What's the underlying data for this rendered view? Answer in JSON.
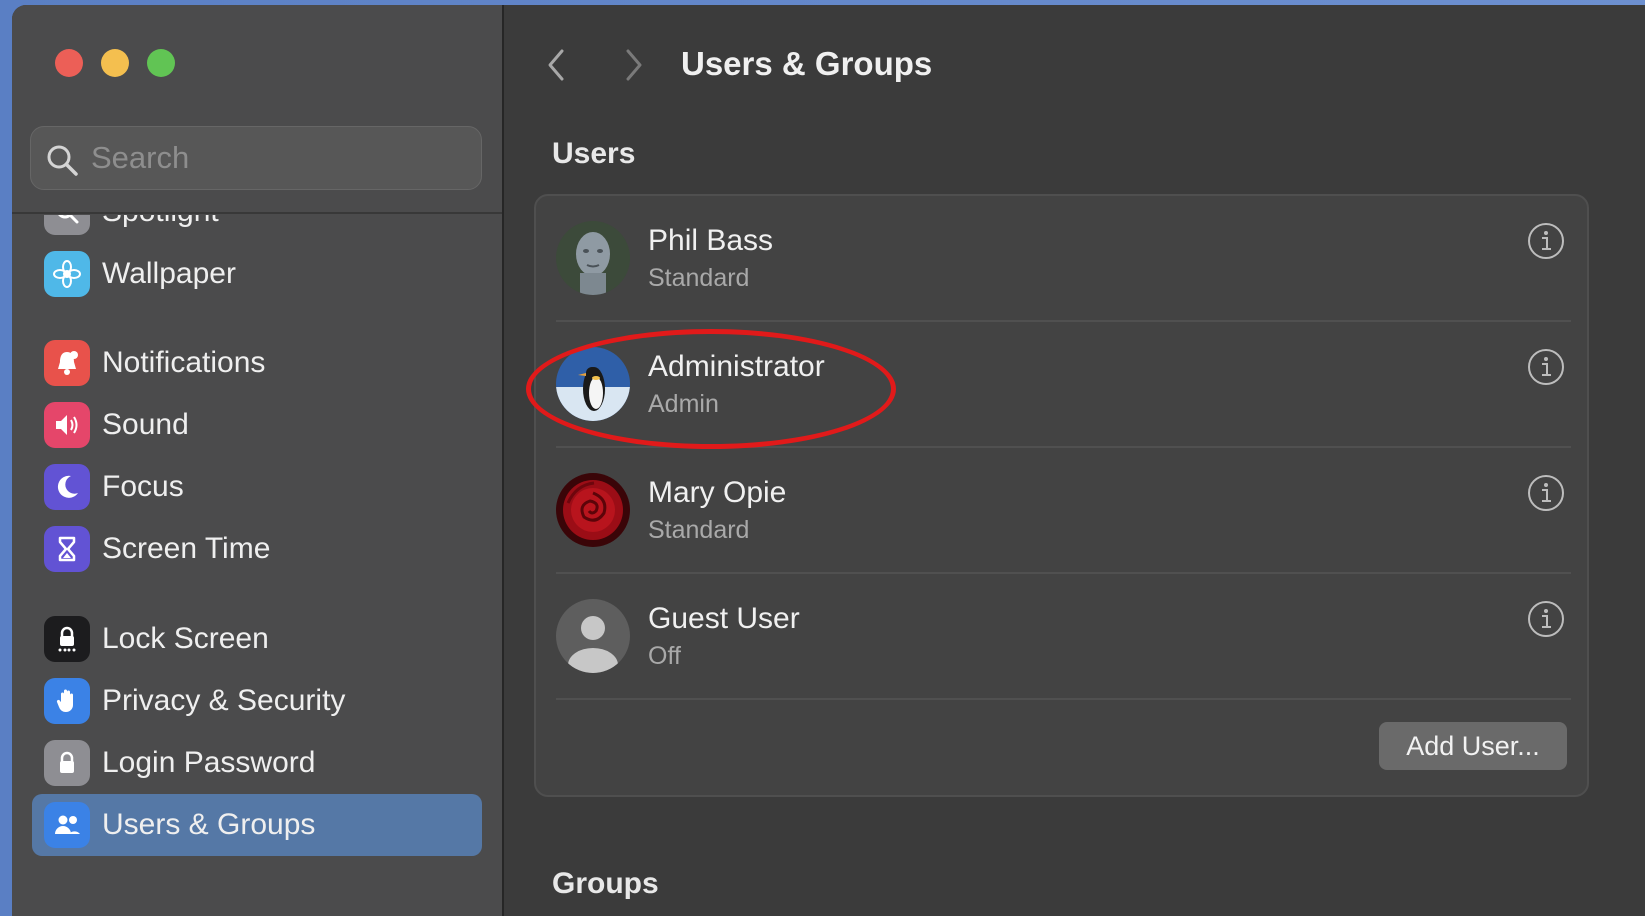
{
  "search": {
    "placeholder": "Search"
  },
  "sidebar": {
    "items": [
      {
        "label": "Spotlight",
        "icon": "spotlight-icon",
        "color": "#8e8e93"
      },
      {
        "label": "Wallpaper",
        "icon": "flower-icon",
        "color": "#4fb8e8"
      },
      {
        "label": "Notifications",
        "icon": "bell-icon",
        "color": "#e8524b"
      },
      {
        "label": "Sound",
        "icon": "speaker-icon",
        "color": "#e5466a"
      },
      {
        "label": "Focus",
        "icon": "moon-icon",
        "color": "#6253d4"
      },
      {
        "label": "Screen Time",
        "icon": "hourglass-icon",
        "color": "#6253d4"
      },
      {
        "label": "Lock Screen",
        "icon": "lock-icon",
        "color": "#1c1c1e"
      },
      {
        "label": "Privacy & Security",
        "icon": "hand-icon",
        "color": "#3b82e6"
      },
      {
        "label": "Login Password",
        "icon": "lock-icon",
        "color": "#8e8e93"
      },
      {
        "label": "Users & Groups",
        "icon": "users-icon",
        "color": "#3b82e6",
        "selected": true
      }
    ]
  },
  "main": {
    "title": "Users & Groups",
    "users_heading": "Users",
    "groups_heading": "Groups",
    "users": [
      {
        "name": "Phil Bass",
        "role": "Standard",
        "avatar": "statue-avatar"
      },
      {
        "name": "Administrator",
        "role": "Admin",
        "avatar": "penguin-avatar"
      },
      {
        "name": "Mary Opie",
        "role": "Standard",
        "avatar": "rose-avatar"
      },
      {
        "name": "Guest User",
        "role": "Off",
        "avatar": "person-avatar"
      }
    ],
    "add_user_label": "Add User..."
  },
  "colors": {
    "highlight": "#e11a1a",
    "selection": "#5578a6"
  }
}
